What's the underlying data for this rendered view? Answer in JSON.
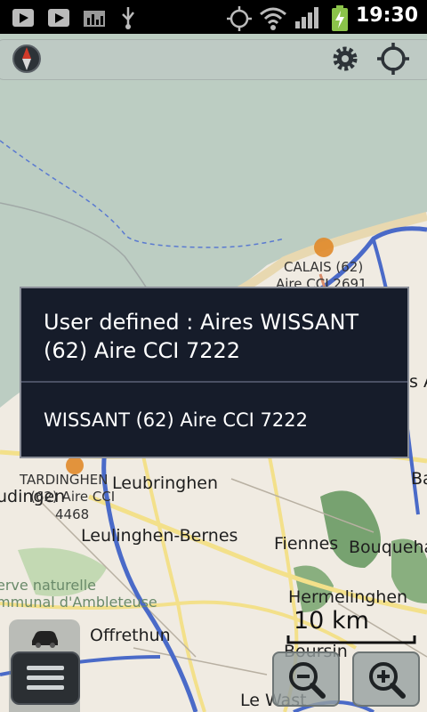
{
  "status_bar": {
    "time": "19:30",
    "icons": [
      "play-store-icon",
      "play-store-icon",
      "signal-graph-icon",
      "usb-icon",
      "gps-icon",
      "wifi-icon",
      "cell-signal-icon",
      "battery-charging-icon"
    ]
  },
  "map_labels": {
    "calais": "CALAIS (62)",
    "calais_aire": "Aire CCI 2691",
    "tardinghen": "TARDINGHEN",
    "aire_cci_62": "(62) Aire CCI",
    "aire_4468": "4468",
    "dingen": "udingen",
    "leubringhen": "Leubringhen",
    "leulinghen": "Leulinghen-Bernes",
    "fiennes": "Fiennes",
    "bouquehault": "Bouqueha",
    "hermelinghen": "Hermelinghen",
    "reserve": "erve naturelle",
    "ambleteuse": "mmunal d'Ambleteuse",
    "offrethun": "Offrethun",
    "boursin": "Boursin",
    "le_wast": "Le Wast",
    "ba": "Ba",
    "s_a": "s A"
  },
  "dialog": {
    "title": "User defined : Aires WISSANT (62) Aire CCI 7222",
    "item": "WISSANT (62) Aire CCI 7222"
  },
  "scale": {
    "label": "10 km"
  },
  "colors": {
    "map_water": "#bccdc2",
    "map_land": "#f0ebe2",
    "dialog_bg": "#161c2a",
    "road_blue": "#4a6ac8",
    "road_yellow": "#f3e08a",
    "forest": "#4f8a4a"
  }
}
